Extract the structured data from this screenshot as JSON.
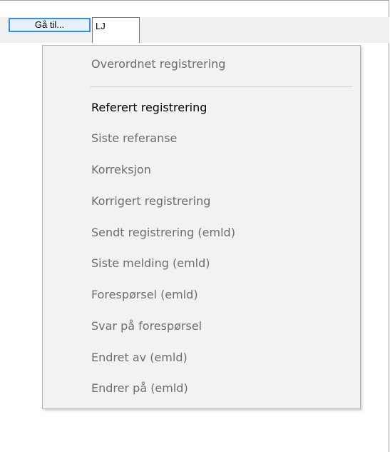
{
  "toolbar": {
    "goto_label": "Gå til...",
    "code_value": "LJ"
  },
  "menu": {
    "items": [
      {
        "label": "Overordnet registrering",
        "enabled": false
      },
      {
        "label": "Referert registrering",
        "enabled": true
      },
      {
        "label": "Siste referanse",
        "enabled": false
      },
      {
        "label": "Korreksjon",
        "enabled": false
      },
      {
        "label": "Korrigert registrering",
        "enabled": false
      },
      {
        "label": "Sendt registrering (emld)",
        "enabled": false
      },
      {
        "label": "Siste melding (emld)",
        "enabled": false
      },
      {
        "label": "Forespørsel (emld)",
        "enabled": false
      },
      {
        "label": "Svar på forespørsel",
        "enabled": false
      },
      {
        "label": "Endret av (emld)",
        "enabled": false
      },
      {
        "label": "Endrer på (emld)",
        "enabled": false
      }
    ]
  }
}
